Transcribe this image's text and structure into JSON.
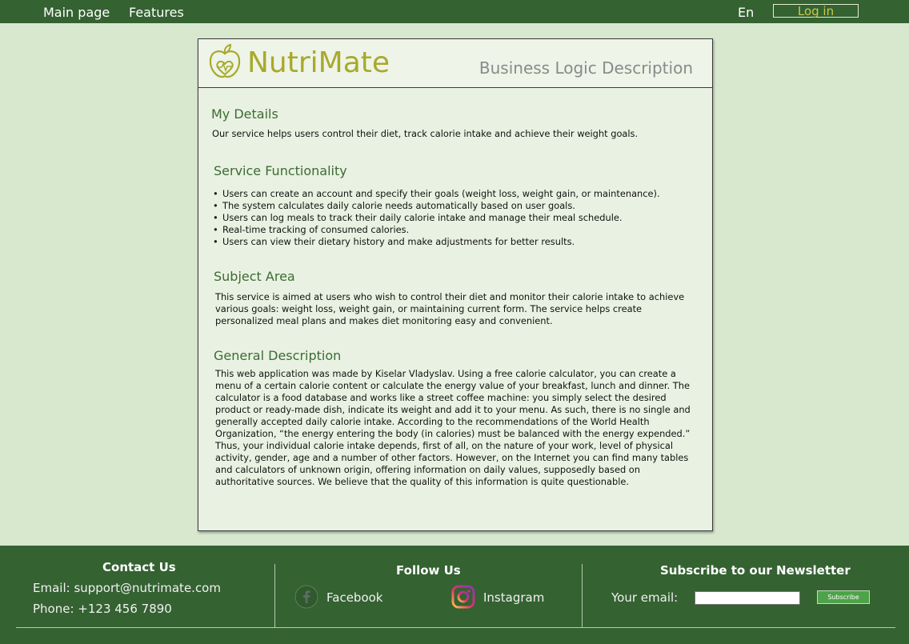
{
  "nav": {
    "main_page": "Main page",
    "features": "Features",
    "language": "En",
    "login": "Log in"
  },
  "card": {
    "brand": "NutriMate",
    "header_subtitle": "Business Logic Description",
    "sections": {
      "details_title": "My Details",
      "details_text": "Our service helps users control their diet, track calorie intake and achieve their weight goals.",
      "functionality_title": "Service Functionality",
      "functionality_items": [
        "Users can create an account and specify their goals (weight loss, weight gain, or maintenance).",
        "The system calculates daily calorie needs automatically based on user goals.",
        "Users can log meals to track their daily calorie intake and manage their meal schedule.",
        "Real-time tracking of consumed calories.",
        "Users can view their dietary history and make adjustments for better results."
      ],
      "subject_title": "Subject Area",
      "subject_text": "This service is aimed at users who wish to control their diet and monitor their calorie intake to achieve various goals: weight loss, weight gain, or maintaining current form. The service helps create personalized meal plans and makes diet monitoring easy and convenient.",
      "general_title": "General Description",
      "general_text": "This web application was made by Kiselar Vladyslav. Using a free calorie calculator, you can create a menu of a certain calorie content or calculate the energy value of your breakfast, lunch and dinner. The calculator is a food database and works like a street coffee machine: you simply select the desired product or ready-made dish, indicate its weight and add it to your menu. As such, there is no single and generally accepted daily calorie intake. According to the recommendations of the World Health Organization, “the energy entering the body (in calories) must be balanced with the energy expended.” Thus, your individual calorie intake depends, first of all, on the nature of your work, level of physical activity, gender, age and a number of other factors. However, on the Internet you can find many tables and calculators of unknown origin, offering information on daily values, supposedly based on authoritative sources. We believe that the quality of this information is quite questionable."
    }
  },
  "footer": {
    "contact_title": "Contact Us",
    "email": "Email: support@nutrimate.com",
    "phone": "Phone: +123 456 7890",
    "follow_title": "Follow Us",
    "facebook": "Facebook",
    "instagram": "Instagram",
    "newsletter_title": "Subscribe to our Newsletter",
    "email_label": "Your email:",
    "email_value": "",
    "subscribe": "Subscribe"
  },
  "colors": {
    "nav_bg": "#346231",
    "page_bg": "#d8e8cf",
    "brand": "#a8a92b",
    "section_title": "#3d6b34",
    "subscribe_btn": "#4ea34a"
  },
  "icons": [
    "nutrimate-logo-icon",
    "facebook-icon",
    "instagram-icon"
  ]
}
